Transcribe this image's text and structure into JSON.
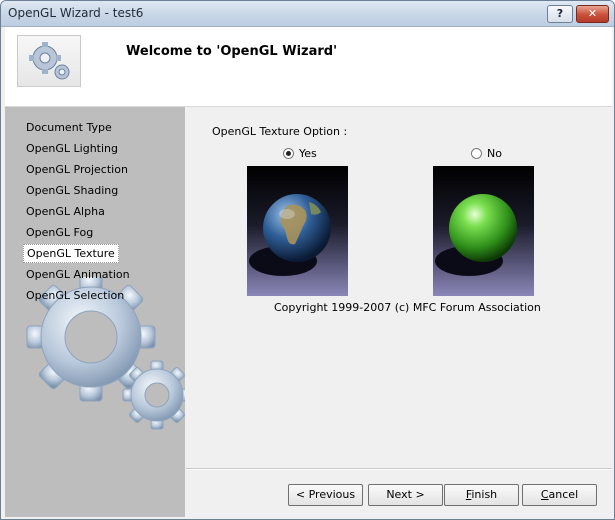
{
  "window": {
    "title": "OpenGL Wizard - test6",
    "help_button": "?",
    "close_button": "✕"
  },
  "header": {
    "welcome": "Welcome to 'OpenGL Wizard'"
  },
  "sidebar": {
    "items": [
      {
        "label": "Document Type"
      },
      {
        "label": "OpenGL Lighting"
      },
      {
        "label": "OpenGL Projection"
      },
      {
        "label": "OpenGL Shading"
      },
      {
        "label": "OpenGL Alpha"
      },
      {
        "label": "OpenGL Fog"
      },
      {
        "label": "OpenGL Texture"
      },
      {
        "label": "OpenGL Animation"
      },
      {
        "label": "OpenGL Selection"
      }
    ],
    "active_index": 6
  },
  "content": {
    "option_label": "OpenGL Texture Option :",
    "yes_label": "Yes",
    "no_label": "No",
    "selected": "Yes",
    "copyright": "Copyright 1999-2007 (c) MFC Forum Association"
  },
  "buttons": {
    "previous": "< Previous",
    "next": "Next >",
    "finish": "Finish",
    "cancel": "Cancel"
  },
  "colors": {
    "sidebar_bg": "#bdbdbd",
    "globe_sphere": "#3a6fa8",
    "green_sphere": "#4cb82e"
  }
}
